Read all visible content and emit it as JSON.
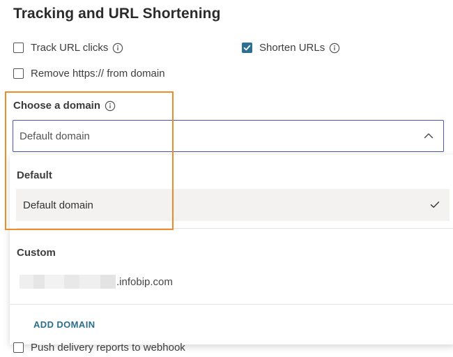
{
  "section": {
    "title": "Tracking and URL Shortening"
  },
  "options": {
    "track_clicks": {
      "label": "Track URL clicks",
      "checked": false
    },
    "shorten_urls": {
      "label": "Shorten URLs",
      "checked": true
    },
    "remove_https": {
      "label": "Remove https:// from domain",
      "checked": false
    },
    "push_delivery": {
      "label": "Push delivery reports to webhook",
      "checked": false
    }
  },
  "domain_select": {
    "label": "Choose a domain",
    "value": "Default domain",
    "groups": [
      {
        "heading": "Default",
        "options": [
          {
            "label": "Default domain",
            "selected": true
          }
        ]
      },
      {
        "heading": "Custom",
        "options": [
          {
            "label": ".infobip.com",
            "selected": false
          }
        ]
      }
    ],
    "add_label": "ADD DOMAIN"
  },
  "colors": {
    "accent": "#2e6f94",
    "select_border": "#4a55b0",
    "highlight": "#ec8c2a",
    "selected_bg": "#f3f2f0"
  },
  "icons": {
    "info": "info-icon",
    "check": "check-icon",
    "chevron": "chevron-up-icon"
  }
}
